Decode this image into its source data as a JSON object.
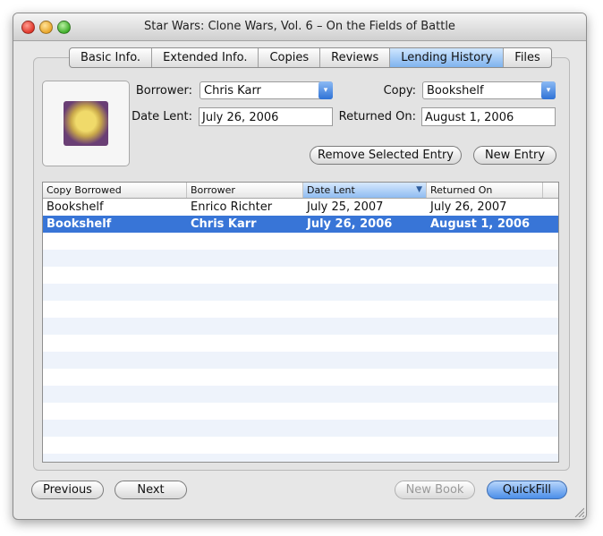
{
  "window": {
    "title": "Star Wars: Clone Wars, Vol. 6 – On the Fields of Battle"
  },
  "tabs": [
    {
      "label": "Basic Info."
    },
    {
      "label": "Extended Info."
    },
    {
      "label": "Copies"
    },
    {
      "label": "Reviews"
    },
    {
      "label": "Lending History",
      "active": true
    },
    {
      "label": "Files"
    }
  ],
  "form": {
    "borrower_label": "Borrower:",
    "borrower_value": "Chris Karr",
    "copy_label": "Copy:",
    "copy_value": "Bookshelf",
    "date_lent_label": "Date Lent:",
    "date_lent_value": "July 26, 2006",
    "returned_on_label": "Returned On:",
    "returned_on_value": "August 1, 2006"
  },
  "actions": {
    "remove_label": "Remove Selected Entry",
    "new_entry_label": "New Entry"
  },
  "table": {
    "columns": [
      "Copy Borrowed",
      "Borrower",
      "Date Lent",
      "Returned On"
    ],
    "sorted_column": "Date Lent",
    "rows": [
      [
        "Bookshelf",
        "Enrico Richter",
        "July 25, 2007",
        "July 26, 2007"
      ],
      [
        "Bookshelf",
        "Chris Karr",
        "July 26, 2006",
        "August 1, 2006"
      ]
    ],
    "selected_row": 1
  },
  "footer": {
    "previous_label": "Previous",
    "next_label": "Next",
    "new_book_label": "New Book",
    "quickfill_label": "QuickFill"
  },
  "colors": {
    "selection": "#3875d7",
    "stripe": "#eef3fb",
    "accent": "#4b8ee9"
  }
}
